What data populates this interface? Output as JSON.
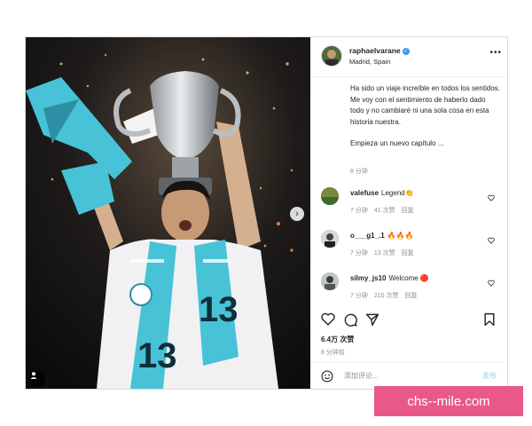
{
  "post": {
    "username": "raphaelvarane",
    "location": "Madrid, Spain",
    "more_icon": "more-horizontal-icon",
    "caption_paragraphs": [
      "Ha sido un viaje increíble en todos los sentidos. Me voy con el sentimiento de haberlo dado todo y no cambiaré ni una sola cosa en esta historia nuestra.",
      "Empieza un nuevo capítulo ..."
    ],
    "caption_time": "8 分钟",
    "likes": "6.4万 次赞",
    "time": "8 分钟前"
  },
  "comments": [
    {
      "user": "valefuse",
      "text": "Legend👏",
      "time": "7 分钟",
      "likes": "41 次赞",
      "reply": "回复"
    },
    {
      "user": "o___g1_.1",
      "text": "🔥🔥🔥",
      "time": "7 分钟",
      "likes": "13 次赞",
      "reply": "回复"
    },
    {
      "user": "silmy_js10",
      "text": "Welcome 🔴",
      "time": "7 分钟",
      "likes": "210 次赞",
      "reply": "回复"
    }
  ],
  "add_comment": {
    "placeholder": "添加评论...",
    "post_label": "发布"
  },
  "photo": {
    "shirt_number": "13"
  },
  "watermark": "chs-‐mile.com",
  "colors": {
    "verified": "#3897f0",
    "scarf": "#48c2d6",
    "watermark_bg": "#e9588b"
  }
}
